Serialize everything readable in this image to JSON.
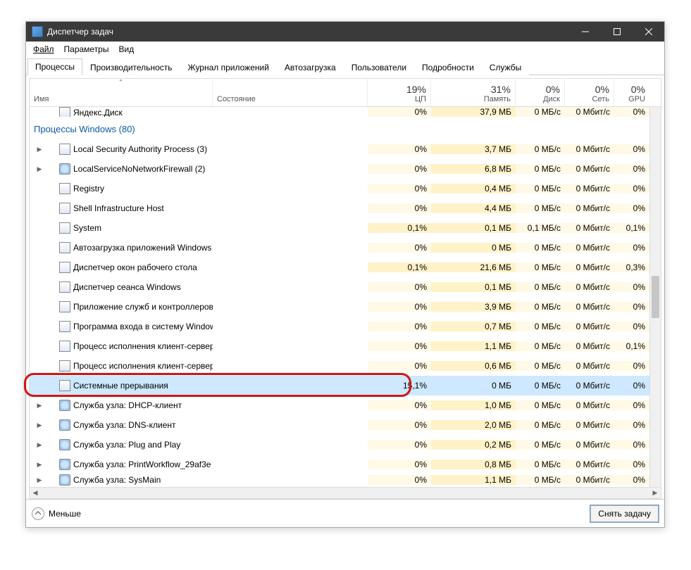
{
  "window": {
    "title": "Диспетчер задач"
  },
  "menu": {
    "file": "Файл",
    "options": "Параметры",
    "view": "Вид"
  },
  "tabs": {
    "processes": "Процессы",
    "performance": "Производительность",
    "apphistory": "Журнал приложений",
    "startup": "Автозагрузка",
    "users": "Пользователи",
    "details": "Подробности",
    "services": "Службы"
  },
  "columns": {
    "name": "Имя",
    "state": "Состояние",
    "cpu": {
      "value": "19%",
      "label": "ЦП"
    },
    "mem": {
      "value": "31%",
      "label": "Память"
    },
    "disk": {
      "value": "0%",
      "label": "Диск"
    },
    "net": {
      "value": "0%",
      "label": "Сеть"
    },
    "gpu": {
      "value": "0%",
      "label": "GPU"
    }
  },
  "group_header": "Процессы Windows (80)",
  "rows": [
    {
      "name": "Яндекс.Диск",
      "cpu": "0%",
      "mem": "37,9 МБ",
      "disk": "0 МБ/с",
      "net": "0 Мбит/с",
      "gpu": "0%",
      "partial": true
    },
    {
      "group": true
    },
    {
      "expand": true,
      "icon": "app",
      "name": "Local Security Authority Process (3)",
      "cpu": "0%",
      "mem": "3,7 МБ",
      "disk": "0 МБ/с",
      "net": "0 Мбит/с",
      "gpu": "0%"
    },
    {
      "expand": true,
      "icon": "gear",
      "name": "LocalServiceNoNetworkFirewall (2)",
      "cpu": "0%",
      "mem": "6,8 МБ",
      "disk": "0 МБ/с",
      "net": "0 Мбит/с",
      "gpu": "0%"
    },
    {
      "icon": "app",
      "name": "Registry",
      "cpu": "0%",
      "mem": "0,4 МБ",
      "disk": "0 МБ/с",
      "net": "0 Мбит/с",
      "gpu": "0%"
    },
    {
      "icon": "app",
      "name": "Shell Infrastructure Host",
      "cpu": "0%",
      "mem": "4,4 МБ",
      "disk": "0 МБ/с",
      "net": "0 Мбит/с",
      "gpu": "0%"
    },
    {
      "icon": "app",
      "name": "System",
      "cpu": "0,1%",
      "mem": "0,1 МБ",
      "disk": "0,1 МБ/с",
      "net": "0 Мбит/с",
      "gpu": "0,1%",
      "hot": true
    },
    {
      "icon": "app",
      "name": "Автозагрузка приложений Windows",
      "cpu": "0%",
      "mem": "0 МБ",
      "disk": "0 МБ/с",
      "net": "0 Мбит/с",
      "gpu": "0%"
    },
    {
      "icon": "app",
      "name": "Диспетчер окон рабочего стола",
      "cpu": "0,1%",
      "mem": "21,6 МБ",
      "disk": "0 МБ/с",
      "net": "0 Мбит/с",
      "gpu": "0,3%",
      "hot": true
    },
    {
      "icon": "app",
      "name": "Диспетчер сеанса  Windows",
      "cpu": "0%",
      "mem": "0,1 МБ",
      "disk": "0 МБ/с",
      "net": "0 Мбит/с",
      "gpu": "0%"
    },
    {
      "icon": "app",
      "name": "Приложение служб и контроллеров",
      "cpu": "0%",
      "mem": "3,9 МБ",
      "disk": "0 МБ/с",
      "net": "0 Мбит/с",
      "gpu": "0%"
    },
    {
      "icon": "app",
      "name": "Программа входа в систему Windows",
      "cpu": "0%",
      "mem": "0,7 МБ",
      "disk": "0 МБ/с",
      "net": "0 Мбит/с",
      "gpu": "0%"
    },
    {
      "icon": "app",
      "name": "Процесс исполнения клиент-сервер",
      "cpu": "0%",
      "mem": "1,1 МБ",
      "disk": "0 МБ/с",
      "net": "0 Мбит/с",
      "gpu": "0,1%"
    },
    {
      "icon": "app",
      "name": "Процесс исполнения клиент-сервер",
      "cpu": "0%",
      "mem": "0,6 МБ",
      "disk": "0 МБ/с",
      "net": "0 Мбит/с",
      "gpu": "0%"
    },
    {
      "icon": "app",
      "name": "Системные прерывания",
      "cpu": "15,1%",
      "mem": "0 МБ",
      "disk": "0 МБ/с",
      "net": "0 Мбит/с",
      "gpu": "0%",
      "selected": true
    },
    {
      "expand": true,
      "icon": "gear",
      "name": "Служба узла: DHCP-клиент",
      "cpu": "0%",
      "mem": "1,0 МБ",
      "disk": "0 МБ/с",
      "net": "0 Мбит/с",
      "gpu": "0%"
    },
    {
      "expand": true,
      "icon": "gear",
      "name": "Служба узла: DNS-клиент",
      "cpu": "0%",
      "mem": "2,0 МБ",
      "disk": "0 МБ/с",
      "net": "0 Мбит/с",
      "gpu": "0%"
    },
    {
      "expand": true,
      "icon": "gear",
      "name": "Служба узла: Plug and Play",
      "cpu": "0%",
      "mem": "0,2 МБ",
      "disk": "0 МБ/с",
      "net": "0 Мбит/с",
      "gpu": "0%"
    },
    {
      "expand": true,
      "icon": "gear",
      "name": "Служба узла: PrintWorkflow_29af3e",
      "cpu": "0%",
      "mem": "0,8 МБ",
      "disk": "0 МБ/с",
      "net": "0 Мбит/с",
      "gpu": "0%"
    },
    {
      "expand": true,
      "icon": "gear",
      "name": "Служба узла: SysMain",
      "cpu": "0%",
      "mem": "1,1 МБ",
      "disk": "0 МБ/с",
      "net": "0 Мбит/с",
      "gpu": "0%",
      "partial_bottom": true
    }
  ],
  "footer": {
    "less": "Меньше",
    "end_task": "Снять задачу"
  }
}
